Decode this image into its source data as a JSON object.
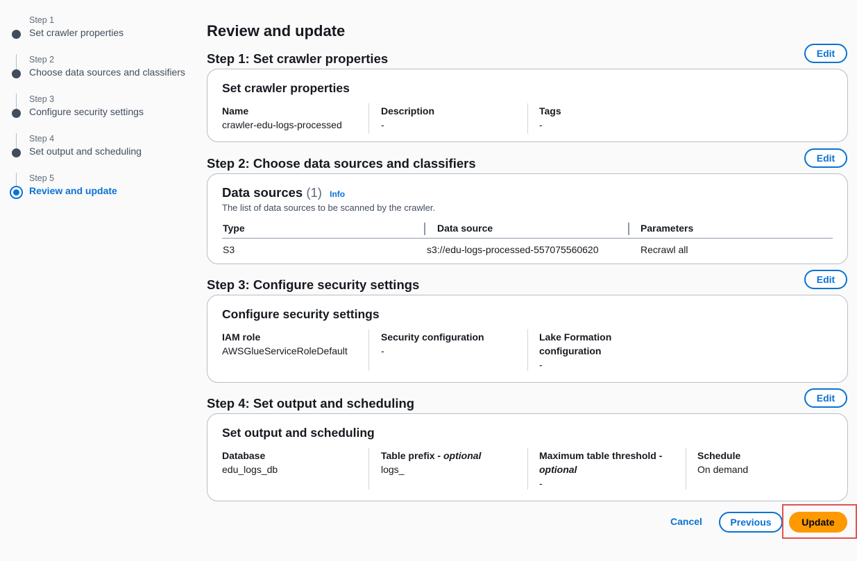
{
  "steps": [
    {
      "num": "Step 1",
      "title": "Set crawler properties"
    },
    {
      "num": "Step 2",
      "title": "Choose data sources and classifiers"
    },
    {
      "num": "Step 3",
      "title": "Configure security settings"
    },
    {
      "num": "Step 4",
      "title": "Set output and scheduling"
    },
    {
      "num": "Step 5",
      "title": "Review and update"
    }
  ],
  "page_title": "Review and update",
  "edit_label": "Edit",
  "section1": {
    "heading": "Step 1: Set crawler properties",
    "card_title": "Set crawler properties",
    "name_label": "Name",
    "name_value": "crawler-edu-logs-processed",
    "desc_label": "Description",
    "desc_value": "-",
    "tags_label": "Tags",
    "tags_value": "-"
  },
  "section2": {
    "heading": "Step 2: Choose data sources and classifiers",
    "card_title": "Data sources",
    "count": "(1)",
    "info": "Info",
    "description": "The list of data sources to be scanned by the crawler.",
    "columns": [
      "Type",
      "Data source",
      "Parameters"
    ],
    "rows": [
      [
        "S3",
        "s3://edu-logs-processed-557075560620",
        "Recrawl all"
      ]
    ]
  },
  "section3": {
    "heading": "Step 3: Configure security settings",
    "card_title": "Configure security settings",
    "iam_label": "IAM role",
    "iam_value": "AWSGlueServiceRoleDefault",
    "secconf_label": "Security configuration",
    "secconf_value": "-",
    "lake_label_1": "Lake Formation",
    "lake_label_2": "configuration",
    "lake_value": "-"
  },
  "section4": {
    "heading": "Step 4: Set output and scheduling",
    "card_title": "Set output and scheduling",
    "db_label": "Database",
    "db_value": "edu_logs_db",
    "prefix_label": "Table prefix - ",
    "prefix_optional": "optional",
    "prefix_value": "logs_",
    "max_label": "Maximum table threshold - ",
    "max_optional": "optional",
    "max_value": "-",
    "schedule_label": "Schedule",
    "schedule_value": "On demand"
  },
  "footer": {
    "cancel": "Cancel",
    "previous": "Previous",
    "update": "Update"
  },
  "colors": {
    "accent": "#0972d3",
    "primary_button": "#ff9900",
    "highlight_border": "#e05252"
  }
}
